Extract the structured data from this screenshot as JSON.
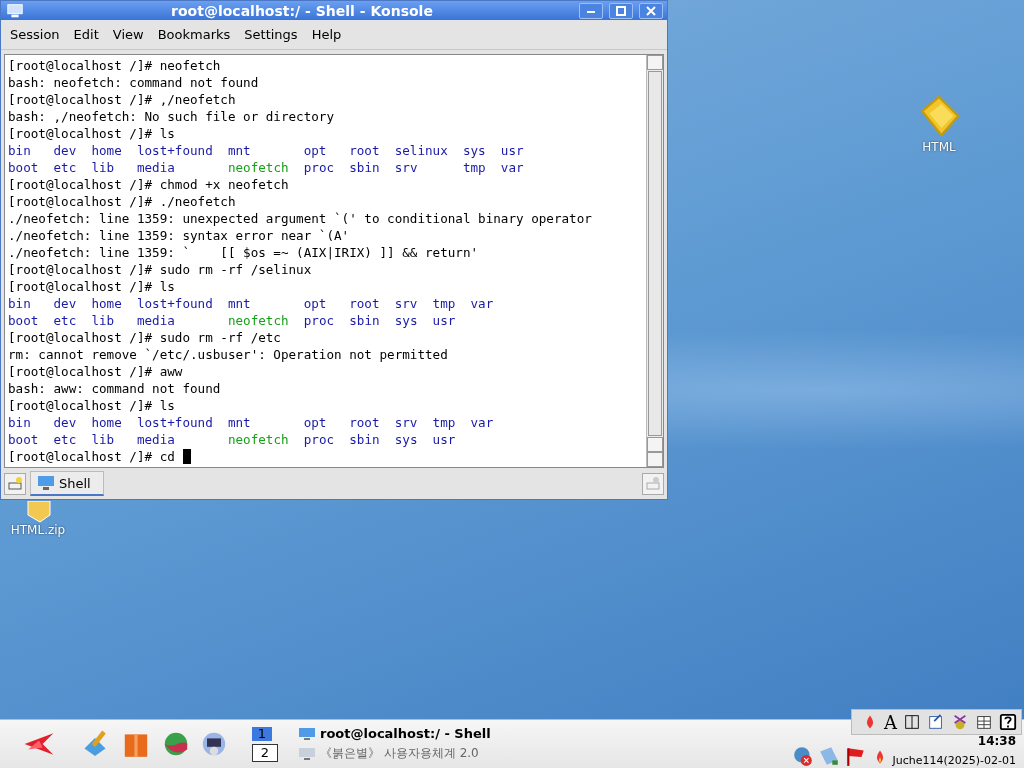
{
  "desktop_icons": [
    {
      "label": "HTML",
      "kind": "folder"
    },
    {
      "label": "HTML.zip",
      "kind": "zip"
    }
  ],
  "window": {
    "title": "root@localhost:/ - Shell - Konsole",
    "menu": [
      "Session",
      "Edit",
      "View",
      "Bookmarks",
      "Settings",
      "Help"
    ],
    "terminal": {
      "lines": [
        {
          "cursor": false,
          "segments": [
            {
              "kind": "plain",
              "text": "[root@localhost /]# neofetch"
            }
          ]
        },
        {
          "cursor": false,
          "segments": [
            {
              "kind": "plain",
              "text": "bash: neofetch: command not found"
            }
          ]
        },
        {
          "cursor": false,
          "segments": [
            {
              "kind": "plain",
              "text": "[root@localhost /]# ,/neofetch"
            }
          ]
        },
        {
          "cursor": false,
          "segments": [
            {
              "kind": "plain",
              "text": "bash: ,/neofetch: No such file or directory"
            }
          ]
        },
        {
          "cursor": false,
          "segments": [
            {
              "kind": "plain",
              "text": "[root@localhost /]# ls"
            }
          ]
        },
        {
          "cursor": false,
          "segments": [
            {
              "kind": "dir",
              "text": "bin   dev  home  lost+found  mnt       opt   root  selinux  sys  usr"
            }
          ]
        },
        {
          "cursor": false,
          "segments": [
            {
              "kind": "dir",
              "text": "boot  etc  lib   media       "
            },
            {
              "kind": "exec",
              "text": "neofetch"
            },
            {
              "kind": "dir",
              "text": "  proc  sbin  srv      tmp  var"
            }
          ]
        },
        {
          "cursor": false,
          "segments": [
            {
              "kind": "plain",
              "text": "[root@localhost /]# chmod +x neofetch"
            }
          ]
        },
        {
          "cursor": false,
          "segments": [
            {
              "kind": "plain",
              "text": "[root@localhost /]# ./neofetch"
            }
          ]
        },
        {
          "cursor": false,
          "segments": [
            {
              "kind": "plain",
              "text": "./neofetch: line 1359: unexpected argument `(' to conditional binary operator"
            }
          ]
        },
        {
          "cursor": false,
          "segments": [
            {
              "kind": "plain",
              "text": "./neofetch: line 1359: syntax error near `(A'"
            }
          ]
        },
        {
          "cursor": false,
          "segments": [
            {
              "kind": "plain",
              "text": "./neofetch: line 1359: `    [[ $os =~ (AIX|IRIX) ]] && return'"
            }
          ]
        },
        {
          "cursor": false,
          "segments": [
            {
              "kind": "plain",
              "text": "[root@localhost /]# sudo rm -rf /selinux"
            }
          ]
        },
        {
          "cursor": false,
          "segments": [
            {
              "kind": "plain",
              "text": "[root@localhost /]# ls"
            }
          ]
        },
        {
          "cursor": false,
          "segments": [
            {
              "kind": "dir",
              "text": "bin   dev  home  lost+found  mnt       opt   root  srv  tmp  var"
            }
          ]
        },
        {
          "cursor": false,
          "segments": [
            {
              "kind": "dir",
              "text": "boot  etc  lib   media       "
            },
            {
              "kind": "exec",
              "text": "neofetch"
            },
            {
              "kind": "dir",
              "text": "  proc  sbin  sys  usr"
            }
          ]
        },
        {
          "cursor": false,
          "segments": [
            {
              "kind": "plain",
              "text": "[root@localhost /]# sudo rm -rf /etc"
            }
          ]
        },
        {
          "cursor": false,
          "segments": [
            {
              "kind": "plain",
              "text": "rm: cannot remove `/etc/.usbuser': Operation not permitted"
            }
          ]
        },
        {
          "cursor": false,
          "segments": [
            {
              "kind": "plain",
              "text": "[root@localhost /]# aww"
            }
          ]
        },
        {
          "cursor": false,
          "segments": [
            {
              "kind": "plain",
              "text": "bash: aww: command not found"
            }
          ]
        },
        {
          "cursor": false,
          "segments": [
            {
              "kind": "plain",
              "text": "[root@localhost /]# ls"
            }
          ]
        },
        {
          "cursor": false,
          "segments": [
            {
              "kind": "dir",
              "text": "bin   dev  home  lost+found  mnt       opt   root  srv  tmp  var"
            }
          ]
        },
        {
          "cursor": false,
          "segments": [
            {
              "kind": "dir",
              "text": "boot  etc  lib   media       "
            },
            {
              "kind": "exec",
              "text": "neofetch"
            },
            {
              "kind": "dir",
              "text": "  proc  sbin  sys  usr"
            }
          ]
        },
        {
          "cursor": true,
          "segments": [
            {
              "kind": "plain",
              "text": "[root@localhost /]# cd"
            }
          ]
        }
      ]
    },
    "tabs": [
      {
        "label": "Shell",
        "selected": true
      }
    ]
  },
  "taskbar": {
    "pager": [
      {
        "label": "1",
        "selected": true
      },
      {
        "label": "2",
        "selected": false
      }
    ],
    "tasks": [
      {
        "label": "root@localhost:/ - Shell",
        "selected": true
      },
      {
        "label": "《붉은별》 사용자용체계 2.0",
        "selected": false
      }
    ],
    "input_toolbar": {
      "font_button": "A"
    },
    "clock": "14:38",
    "date": "Juche114(2025)-02-01"
  }
}
